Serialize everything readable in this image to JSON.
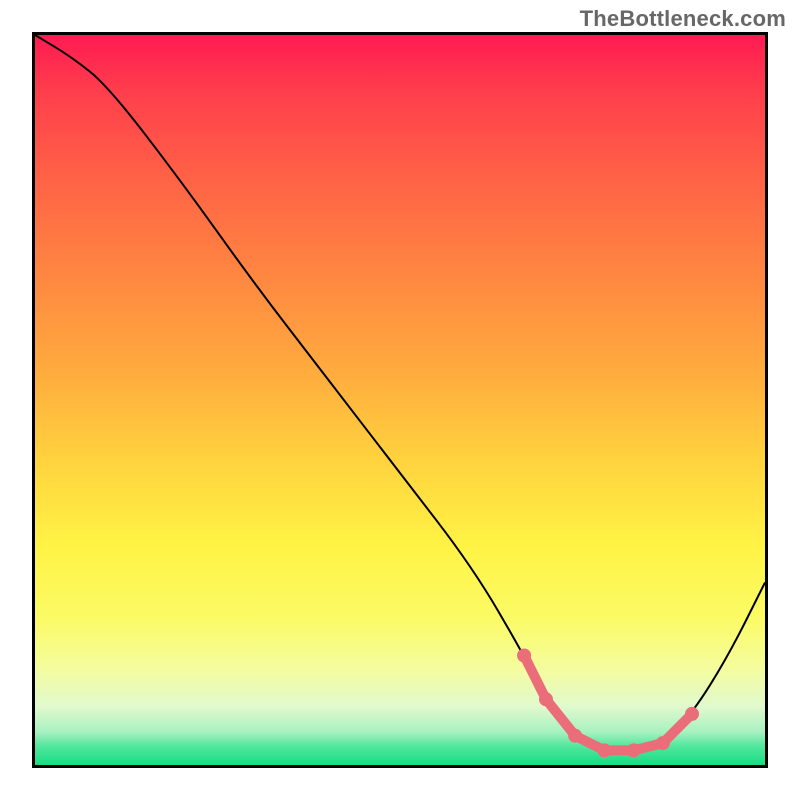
{
  "watermark": "TheBottleneck.com",
  "chart_data": {
    "type": "line",
    "title": "",
    "xlabel": "",
    "ylabel": "",
    "xlim": [
      0,
      100
    ],
    "ylim": [
      0,
      100
    ],
    "series": [
      {
        "name": "curve",
        "x": [
          0,
          5,
          10,
          20,
          30,
          40,
          50,
          60,
          67,
          70,
          74,
          78,
          82,
          86,
          90,
          95,
          100
        ],
        "y": [
          100,
          97,
          93,
          80,
          66,
          53,
          40,
          27,
          15,
          9,
          4,
          2,
          2,
          3,
          7,
          15,
          25
        ]
      },
      {
        "name": "highlight-dots",
        "x": [
          67,
          70,
          74,
          78,
          82,
          86,
          90
        ],
        "y": [
          15,
          9,
          4,
          2,
          2,
          3,
          7
        ]
      }
    ],
    "colors": {
      "curve": "#000000",
      "highlight": "#ea6d79",
      "gradient_top": "#ff1b52",
      "gradient_mid": "#fff345",
      "gradient_bottom": "#17dd82"
    }
  }
}
